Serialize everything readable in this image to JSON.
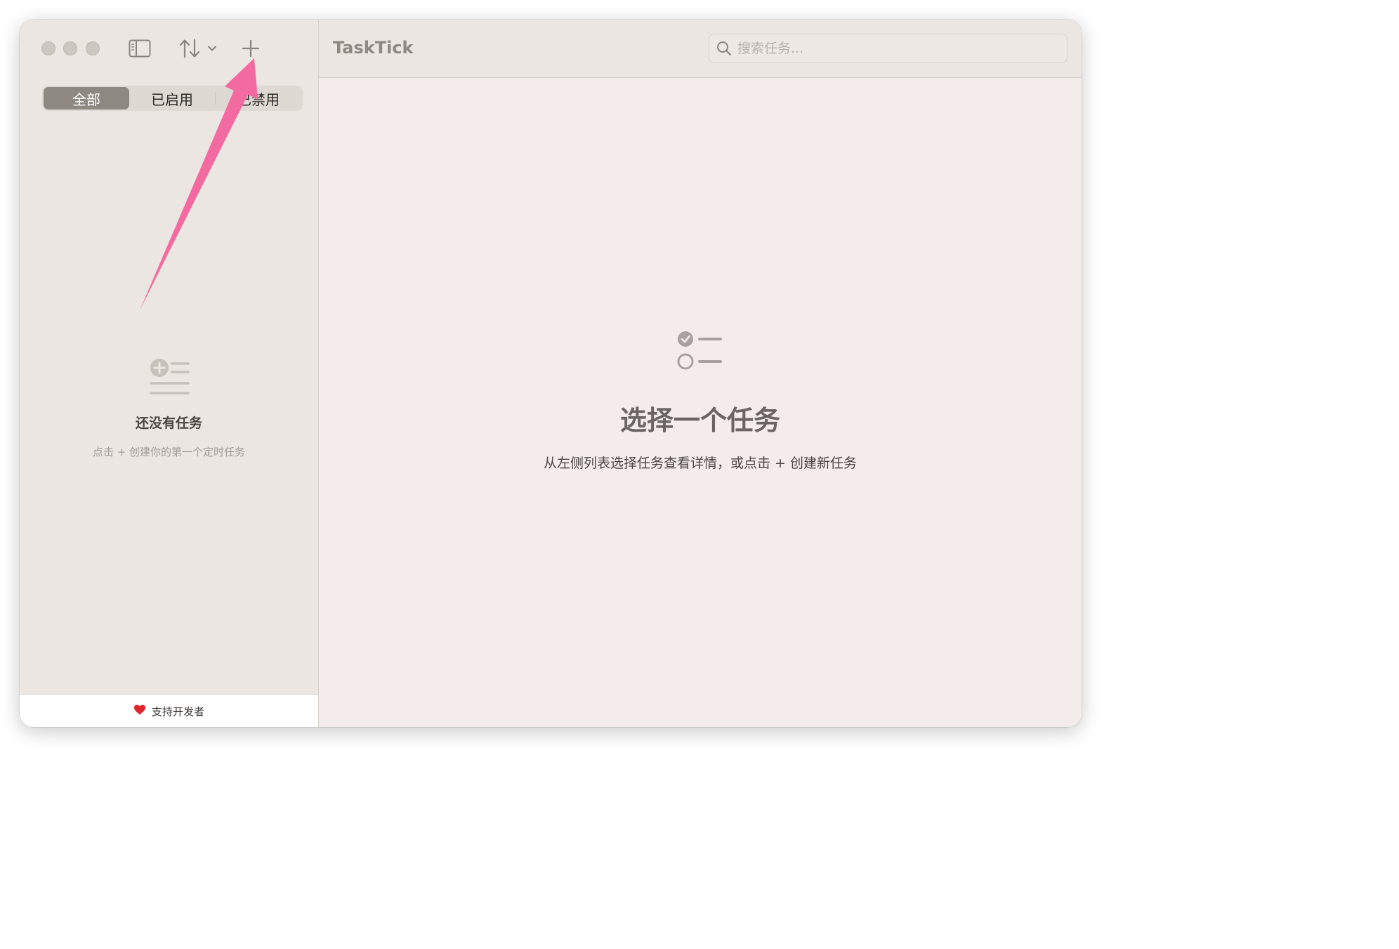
{
  "window": {
    "title": "TaskTick"
  },
  "toolbar": {
    "icons": [
      "close-traffic-light",
      "minimize-traffic-light",
      "zoom-traffic-light",
      "sidebar-toggle-icon",
      "sort-icon",
      "chevron-down-icon",
      "plus-icon"
    ]
  },
  "filter": {
    "segments": [
      "全部",
      "已启用",
      "已禁用"
    ],
    "selected": "全部"
  },
  "sidebar_empty": {
    "icon": "add-list-icon",
    "title": "还没有任务",
    "hint": "点击 + 创建你的第一个定时任务"
  },
  "support": {
    "icon": "heart-icon",
    "label": "支持开发者",
    "color": "#e0242c"
  },
  "search": {
    "placeholder": "搜索任务...",
    "value": ""
  },
  "detail_empty": {
    "icon": "checklist-icon",
    "title": "选择一个任务",
    "subtitle": "从左侧列表选择任务查看详情，或点击 + 创建新任务"
  },
  "annotation": {
    "type": "arrow",
    "color": "#f36aa0",
    "points_to": "plus-icon"
  }
}
